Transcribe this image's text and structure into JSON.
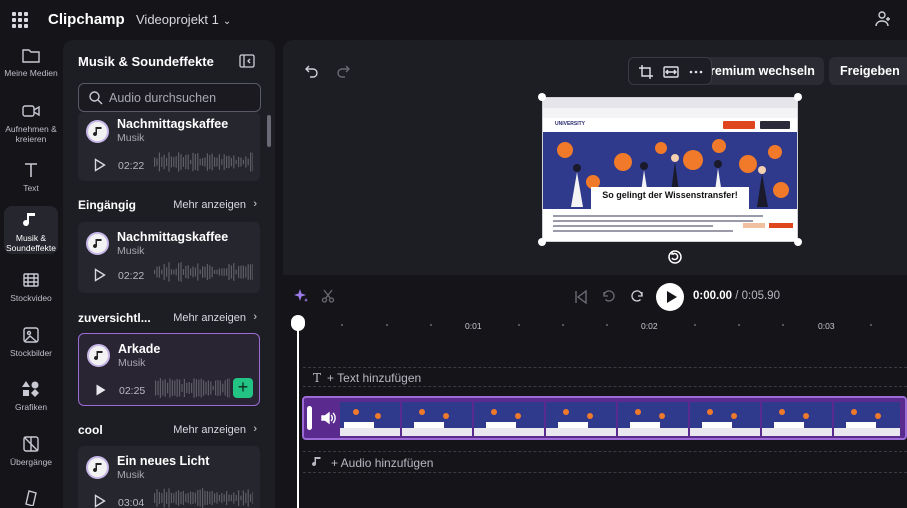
{
  "app": {
    "name": "Clipchamp",
    "project_name": "Videoprojekt 1"
  },
  "rail": {
    "items": [
      {
        "label": "Meine Medien",
        "icon": "folder-icon"
      },
      {
        "label": "Aufnehmen & kreieren",
        "icon": "camera-icon"
      },
      {
        "label": "Text",
        "icon": "text-icon"
      },
      {
        "label": "Musik & Soundeffekte",
        "icon": "music-icon",
        "active": true
      },
      {
        "label": "Stockvideo",
        "icon": "film-icon"
      },
      {
        "label": "Stockbilder",
        "icon": "image-icon"
      },
      {
        "label": "Grafiken",
        "icon": "shapes-icon"
      },
      {
        "label": "Übergänge",
        "icon": "transition-icon"
      }
    ]
  },
  "panel": {
    "title": "Musik & Soundeffekte",
    "search_placeholder": "Audio durchsuchen",
    "more_label": "Mehr anzeigen",
    "cards": [
      {
        "title": "Nachmittagskaffee",
        "subtitle": "Musik",
        "duration": "02:22"
      },
      {
        "title": "Nachmittagskaffee",
        "subtitle": "Musik",
        "duration": "02:22"
      },
      {
        "title": "Arkade",
        "subtitle": "Musik",
        "duration": "02:25",
        "selected": true
      },
      {
        "title": "Ein neues Licht",
        "subtitle": "Musik",
        "duration": "03:04"
      }
    ],
    "sections": [
      {
        "name": "Eingängig"
      },
      {
        "name": "zuversichtl..."
      },
      {
        "name": "cool"
      }
    ]
  },
  "stage": {
    "premium_label": "remium wechseln",
    "share_label": "Freigeben",
    "preview": {
      "site_logo": "UNIVERSITY",
      "headline": "So gelingt der Wissenstransfer!"
    }
  },
  "timeline": {
    "time_current": "0:00.00",
    "time_total": "/ 0:05.90",
    "ruler_labels": [
      "0:01",
      "0:02",
      "0:03"
    ],
    "text_track_label": "+ Text hinzufügen",
    "audio_track_label": "+ Audio hinzufügen"
  },
  "colors": {
    "accent": "#9b6bd6",
    "add_green": "#22c383",
    "clip_purple": "#5a2a8f"
  }
}
